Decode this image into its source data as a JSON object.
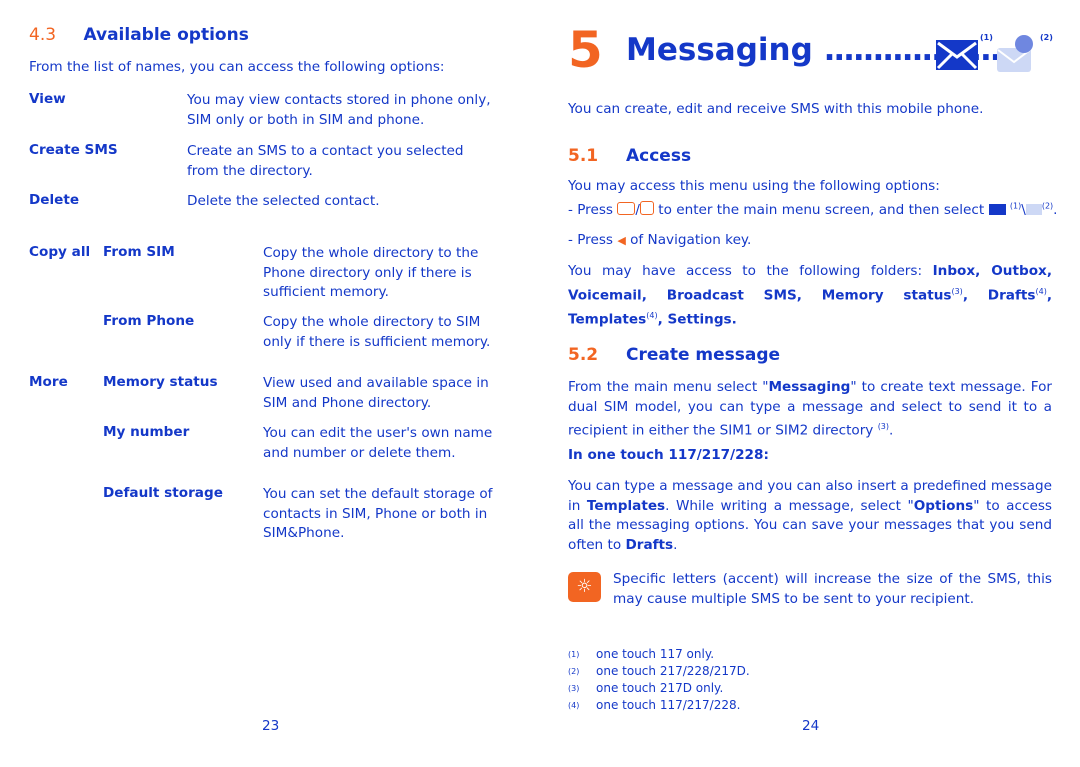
{
  "left": {
    "section_num": "4.3",
    "section_title": "Available options",
    "intro": "From the list of names, you can access the following options:",
    "options": [
      {
        "label": "View",
        "desc": "You may view contacts stored in phone only, SIM only or both in SIM and phone."
      },
      {
        "label": "Create SMS",
        "desc": "Create an SMS to a contact you selected from the directory."
      },
      {
        "label": "Delete",
        "desc": "Delete the selected contact."
      }
    ],
    "copy_all": {
      "label": "Copy all",
      "items": [
        {
          "label": "From SIM",
          "desc": "Copy the whole directory to the Phone directory only if there is sufficient memory."
        },
        {
          "label": "From Phone",
          "desc": "Copy the whole directory to SIM only if there is sufficient memory."
        }
      ]
    },
    "more": {
      "label": "More",
      "items": [
        {
          "label": "Memory status",
          "desc": "View used and available space in SIM and Phone directory."
        },
        {
          "label": "My number",
          "desc": "You can edit the user's own name and number or delete them."
        },
        {
          "label": "Default storage",
          "desc": "You can set the default storage of contacts in SIM, Phone or both in SIM&Phone."
        }
      ]
    },
    "page_number": "23"
  },
  "right": {
    "chapter_num": "5",
    "chapter_title": "Messaging",
    "dots": "..................",
    "icon_refs": [
      "(1)",
      "(2)"
    ],
    "intro": "You can create, edit and receive SMS with this mobile phone.",
    "access": {
      "num": "5.1",
      "title": "Access",
      "intro": "You may access this menu using the following options:",
      "press1_a": "- Press ",
      "press1_b": " to enter the main menu screen, and then select ",
      "press1_ref1": "(1)",
      "press1_sep": "\\",
      "press1_ref2": "(2)",
      "press1_end": ".",
      "press2_a": "- Press ",
      "press2_b": " of Navigation key.",
      "folders_intro": "You may have access to the following folders: ",
      "folders": "Inbox, Outbox, Voicemail, Broadcast SMS, Memory status",
      "ref3": "(3)",
      "drafts": ", Drafts",
      "ref4a": "(4)",
      "templates": ", Templates",
      "ref4b": "(4)",
      "settings": ", Settings."
    },
    "create": {
      "num": "5.2",
      "title": "Create message",
      "p1a": "From the main menu select \"",
      "p1b": "Messaging",
      "p1c": "\" to create text message. For dual SIM model, you can type a message and select to send it to a recipient in either the SIM1 or SIM2 directory ",
      "p1ref": "(3)",
      "p1d": ".",
      "model_heading": "In one touch 117/217/228:",
      "p2a": "You can type a message and you can also insert a predefined message in ",
      "p2b": "Templates",
      "p2c": ". While writing a message, select \"",
      "p2d": "Options",
      "p2e": "\" to access all the messaging options. You can save your messages that you send often to ",
      "p2f": "Drafts",
      "p2g": ".",
      "tip": "Specific letters (accent) will increase the size of the SMS, this may cause multiple SMS to be sent to your recipient."
    },
    "footnotes": [
      {
        "mark": "(1)",
        "text": "one touch 117 only."
      },
      {
        "mark": "(2)",
        "text": "one touch 217/228/217D."
      },
      {
        "mark": "(3)",
        "text": "one touch 217D only."
      },
      {
        "mark": "(4)",
        "text": "one touch 117/217/228."
      }
    ],
    "page_number": "24"
  },
  "colors": {
    "text": "#1438c8",
    "accent": "#f26522"
  }
}
